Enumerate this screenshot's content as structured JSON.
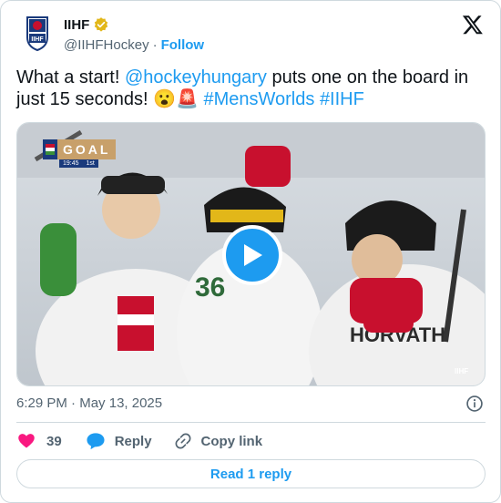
{
  "author": {
    "name": "IIHF",
    "handle": "@IIHFHockey",
    "separator": "·",
    "follow_label": "Follow"
  },
  "tweet": {
    "text_start": "What a start! ",
    "mention": "@hockeyhungary",
    "text_mid": " puts one on the board in just 15 seconds! ",
    "emojis": "😮🚨",
    "hashtag1": "#MensWorlds",
    "hashtag2": "#IIHF"
  },
  "media": {
    "scorebug_label": "GOAL",
    "scorebug_clock": "19:45",
    "scorebug_period": "1st",
    "watermark": "IIHF",
    "jersey_text": "HORVATH"
  },
  "timestamp": {
    "time": "6:29 PM",
    "separator": "·",
    "date": "May 13, 2025"
  },
  "actions": {
    "like_count": "39",
    "reply_label": "Reply",
    "copy_label": "Copy link"
  },
  "read_reply_label": "Read 1 reply",
  "colors": {
    "accent": "#1d9bf0",
    "like": "#f91880",
    "text": "#0f1419",
    "muted": "#536471",
    "border": "#cfd9de"
  }
}
